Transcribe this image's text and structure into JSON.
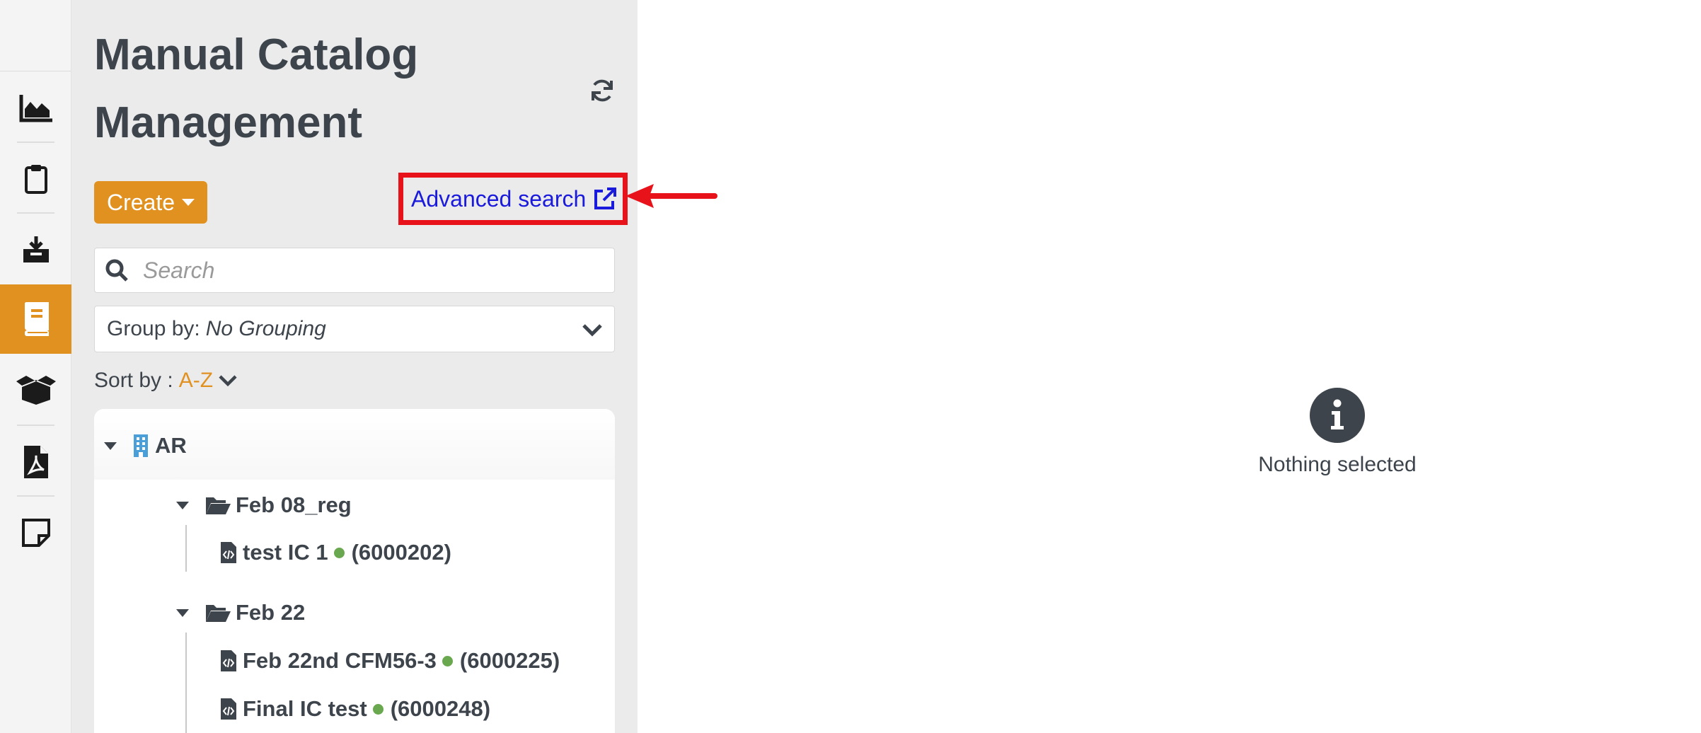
{
  "app": {
    "title": "Manual Catalog Management"
  },
  "nav": {
    "items": [
      {
        "icon": "area-chart-icon",
        "active": false
      },
      {
        "icon": "clipboard-icon",
        "active": false
      },
      {
        "icon": "inbox-download-icon",
        "active": false
      },
      {
        "icon": "catalog-book-icon",
        "active": true
      },
      {
        "icon": "open-box-icon",
        "active": false
      },
      {
        "icon": "pdf-file-icon",
        "active": false
      },
      {
        "icon": "sticky-note-icon",
        "active": false
      }
    ]
  },
  "toolbar": {
    "create_label": "Create",
    "advanced_search_label": "Advanced search"
  },
  "search": {
    "placeholder": "Search"
  },
  "group_by": {
    "label": "Group by:",
    "value": "No Grouping"
  },
  "sort_by": {
    "label": "Sort by :",
    "value": "A-Z"
  },
  "tree": {
    "root": {
      "label": "AR"
    },
    "folders": [
      {
        "label": "Feb 08_reg",
        "items": [
          {
            "name": "test IC 1",
            "id": "(6000202)",
            "status_color": "#6aa84f"
          }
        ]
      },
      {
        "label": "Feb 22",
        "items": [
          {
            "name": "Feb 22nd CFM56-3",
            "id": "(6000225)",
            "status_color": "#6aa84f"
          },
          {
            "name": "Final IC test",
            "id": "(6000248)",
            "status_color": "#6aa84f"
          }
        ]
      }
    ]
  },
  "detail": {
    "empty_text": "Nothing selected"
  },
  "colors": {
    "accent": "#e19120",
    "highlight": "#e8131a",
    "link": "#1a1adc",
    "text": "#3d444c"
  }
}
